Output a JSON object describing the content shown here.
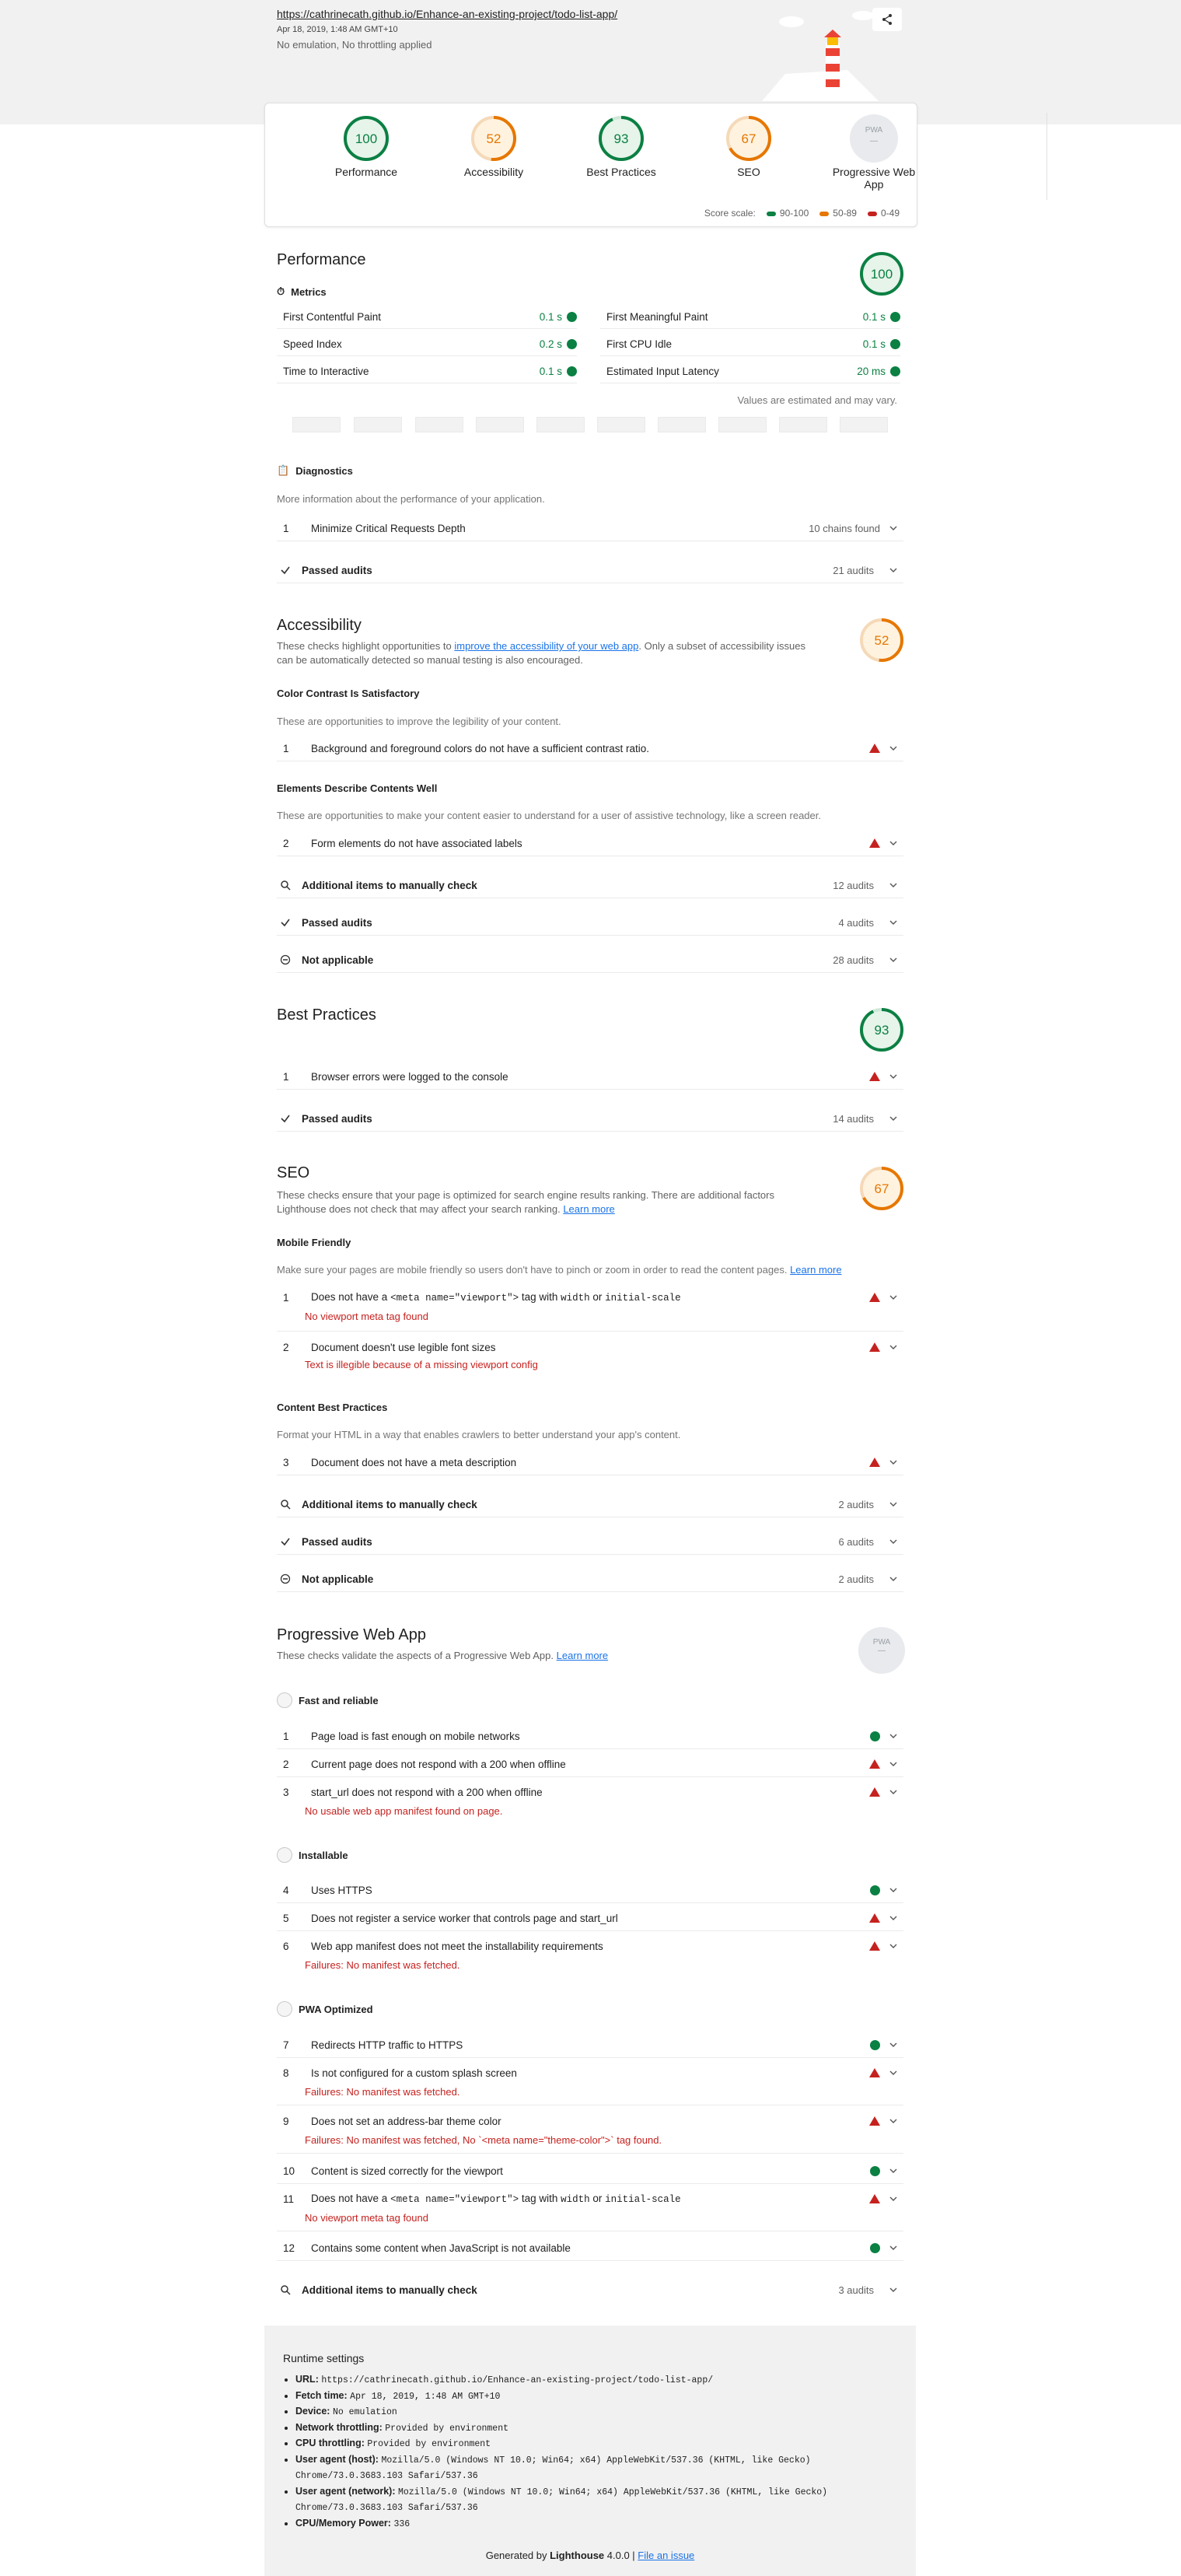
{
  "header": {
    "url": "https://cathrinecath.github.io/Enhance-an-existing-project/todo-list-app/",
    "fetch_time": "Apr 18, 2019, 1:48 AM GMT+10",
    "emulation": "No emulation, No throttling applied"
  },
  "scores": [
    {
      "label": "Performance",
      "value": "100",
      "color": "#0b8043"
    },
    {
      "label": "Accessibility",
      "value": "52",
      "color": "#e67700"
    },
    {
      "label": "Best Practices",
      "value": "93",
      "color": "#0b8043"
    },
    {
      "label": "SEO",
      "value": "67",
      "color": "#e67700"
    }
  ],
  "pwa": {
    "label": "Progressive Web App",
    "badge": "PWA"
  },
  "scale": {
    "label": "Score scale:",
    "good": "90-100",
    "avg": "50-89",
    "bad": "0-49"
  },
  "performance": {
    "title": "Performance",
    "score": "100",
    "metrics_title": "Metrics",
    "metrics": [
      {
        "name": "First Contentful Paint",
        "value": "0.1 s"
      },
      {
        "name": "First Meaningful Paint",
        "value": "0.1 s"
      },
      {
        "name": "Speed Index",
        "value": "0.2 s"
      },
      {
        "name": "First CPU Idle",
        "value": "0.1 s"
      },
      {
        "name": "Time to Interactive",
        "value": "0.1 s"
      },
      {
        "name": "Estimated Input Latency",
        "value": "20 ms"
      }
    ],
    "estimate_note": "Values are estimated and may vary.",
    "diagnostics_title": "Diagnostics",
    "diagnostics_desc": "More information about the performance of your application.",
    "diag_items": [
      {
        "num": "1",
        "text": "Minimize Critical Requests Depth",
        "meta": "10 chains found"
      }
    ],
    "passed_label": "Passed audits",
    "passed_meta": "21 audits"
  },
  "accessibility": {
    "title": "Accessibility",
    "score": "52",
    "desc_pre": "These checks highlight opportunities to ",
    "desc_link": "improve the accessibility of your web app",
    "desc_post": ". Only a subset of accessibility issues can be automatically detected so manual testing is also encouraged.",
    "g1_title": "Color Contrast Is Satisfactory",
    "g1_desc": "These are opportunities to improve the legibility of your content.",
    "g1_item": "Background and foreground colors do not have a sufficient contrast ratio.",
    "g2_title": "Elements Describe Contents Well",
    "g2_desc": "These are opportunities to make your content easier to understand for a user of assistive technology, like a screen reader.",
    "g2_item": "Form elements do not have associated labels",
    "manual_label": "Additional items to manually check",
    "manual_meta": "12 audits",
    "passed_label": "Passed audits",
    "passed_meta": "4 audits",
    "na_label": "Not applicable",
    "na_meta": "28 audits"
  },
  "best_practices": {
    "title": "Best Practices",
    "score": "93",
    "item": "Browser errors were logged to the console",
    "passed_label": "Passed audits",
    "passed_meta": "14 audits"
  },
  "seo": {
    "title": "SEO",
    "score": "67",
    "desc": "These checks ensure that your page is optimized for search engine results ranking. There are additional factors Lighthouse does not check that may affect your search ranking. ",
    "learn_more": "Learn more",
    "mf_title": "Mobile Friendly",
    "mf_desc": "Make sure your pages are mobile friendly so users don't have to pinch or zoom in order to read the content pages. ",
    "item1_a": "Does not have a ",
    "item1_code1": "<meta name=\"viewport\">",
    "item1_b": " tag with ",
    "item1_code2": "width",
    "item1_c": " or ",
    "item1_code3": "initial-scale",
    "item1_err": "No viewport meta tag found",
    "item2": "Document doesn't use legible font sizes",
    "item2_err": "Text is illegible because of a missing viewport config",
    "cbp_title": "Content Best Practices",
    "cbp_desc": "Format your HTML in a way that enables crawlers to better understand your app's content.",
    "item3": "Document does not have a meta description",
    "manual_label": "Additional items to manually check",
    "manual_meta": "2 audits",
    "passed_label": "Passed audits",
    "passed_meta": "6 audits",
    "na_label": "Not applicable",
    "na_meta": "2 audits"
  },
  "pwa_section": {
    "title": "Progressive Web App",
    "desc": "These checks validate the aspects of a Progressive Web App. ",
    "learn_more": "Learn more",
    "fr_title": "Fast and reliable",
    "fr1": "Page load is fast enough on mobile networks",
    "fr2": "Current page does not respond with a 200 when offline",
    "fr3": "start_url does not respond with a 200 when offline",
    "fr3_err": "No usable web app manifest found on page.",
    "in_title": "Installable",
    "in4": "Uses HTTPS",
    "in5": "Does not register a service worker that controls page and start_url",
    "in6": "Web app manifest does not meet the installability requirements",
    "in6_err": "Failures: No manifest was fetched.",
    "po_title": "PWA Optimized",
    "po7": "Redirects HTTP traffic to HTTPS",
    "po8": "Is not configured for a custom splash screen",
    "po8_err": "Failures: No manifest was fetched.",
    "po9": "Does not set an address-bar theme color",
    "po9_err": "Failures: No manifest was fetched, No `<meta name=\"theme-color\">` tag found.",
    "po10": "Content is sized correctly for the viewport",
    "po11_a": "Does not have a ",
    "po11_code1": "<meta name=\"viewport\">",
    "po11_b": " tag with ",
    "po11_code2": "width",
    "po11_c": " or ",
    "po11_code3": "initial-scale",
    "po11_err": "No viewport meta tag found",
    "po12": "Contains some content when JavaScript is not available",
    "manual_label": "Additional items to manually check",
    "manual_meta": "3 audits"
  },
  "runtime": {
    "title": "Runtime settings",
    "items": [
      {
        "k": "URL:",
        "v": "https://cathrinecath.github.io/Enhance-an-existing-project/todo-list-app/"
      },
      {
        "k": "Fetch time:",
        "v": "Apr 18, 2019, 1:48 AM GMT+10"
      },
      {
        "k": "Device:",
        "v": "No emulation"
      },
      {
        "k": "Network throttling:",
        "v": "Provided by environment"
      },
      {
        "k": "CPU throttling:",
        "v": "Provided by environment"
      },
      {
        "k": "User agent (host):",
        "v": "Mozilla/5.0 (Windows NT 10.0; Win64; x64) AppleWebKit/537.36 (KHTML, like Gecko) Chrome/73.0.3683.103 Safari/537.36"
      },
      {
        "k": "User agent (network):",
        "v": "Mozilla/5.0 (Windows NT 10.0; Win64; x64) AppleWebKit/537.36 (KHTML, like Gecko) Chrome/73.0.3683.103 Safari/537.36"
      },
      {
        "k": "CPU/Memory Power:",
        "v": "336"
      }
    ],
    "footer_pre": "Generated by ",
    "footer_brand": "Lighthouse",
    "footer_version": " 4.0.0 | ",
    "footer_link": "File an issue"
  }
}
